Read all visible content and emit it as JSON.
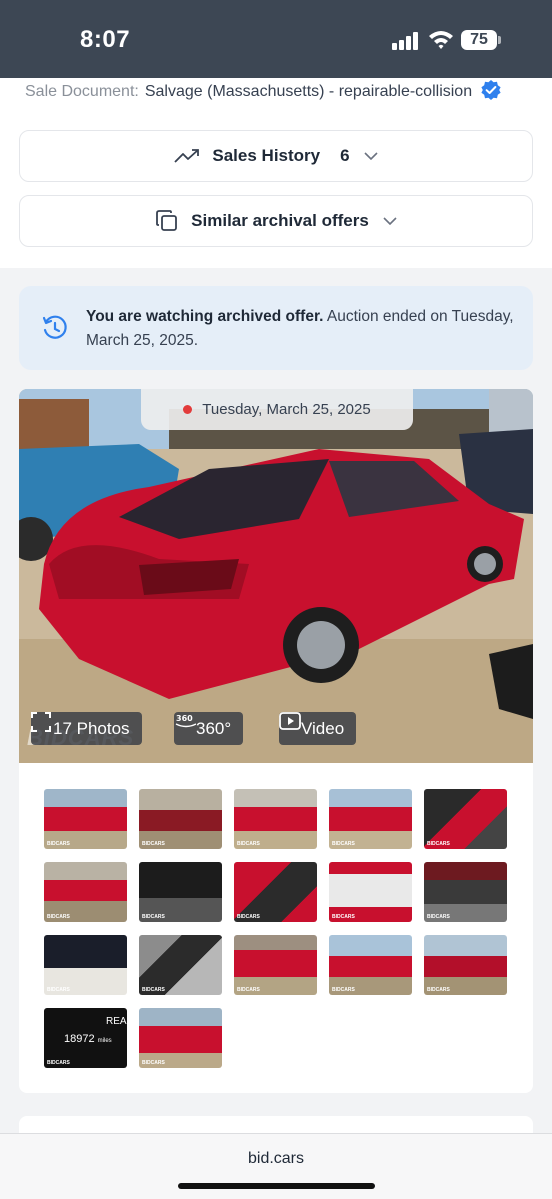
{
  "status_bar": {
    "time": "8:07",
    "battery": "75"
  },
  "sale_document": {
    "label": "Sale Document:",
    "value": "Salvage (Massachusetts) - repairable-collision"
  },
  "sales_history": {
    "label": "Sales History",
    "count": "6"
  },
  "similar_offers": {
    "label": "Similar archival offers"
  },
  "archived_notice": {
    "bold": "You are watching archived offer.",
    "text": " Auction ended on Tuesday, March 25, 2025."
  },
  "gallery": {
    "date": "Tuesday, March 25, 2025",
    "photos_label": "17 Photos",
    "view360_label": "360°",
    "video_label": "Video",
    "watermark": "BIDCARS",
    "thumb_watermark": "BIDCARS",
    "thumbnail_count": 17,
    "odometer": "18972",
    "odometer_unit": "miles",
    "dash_text": "REA"
  },
  "browser": {
    "url": "bid.cars"
  },
  "colors": {
    "accent": "#2f80ed",
    "car_red": "#c8102e",
    "status_bg": "#3d4754",
    "info_bg": "#e5eef8"
  }
}
